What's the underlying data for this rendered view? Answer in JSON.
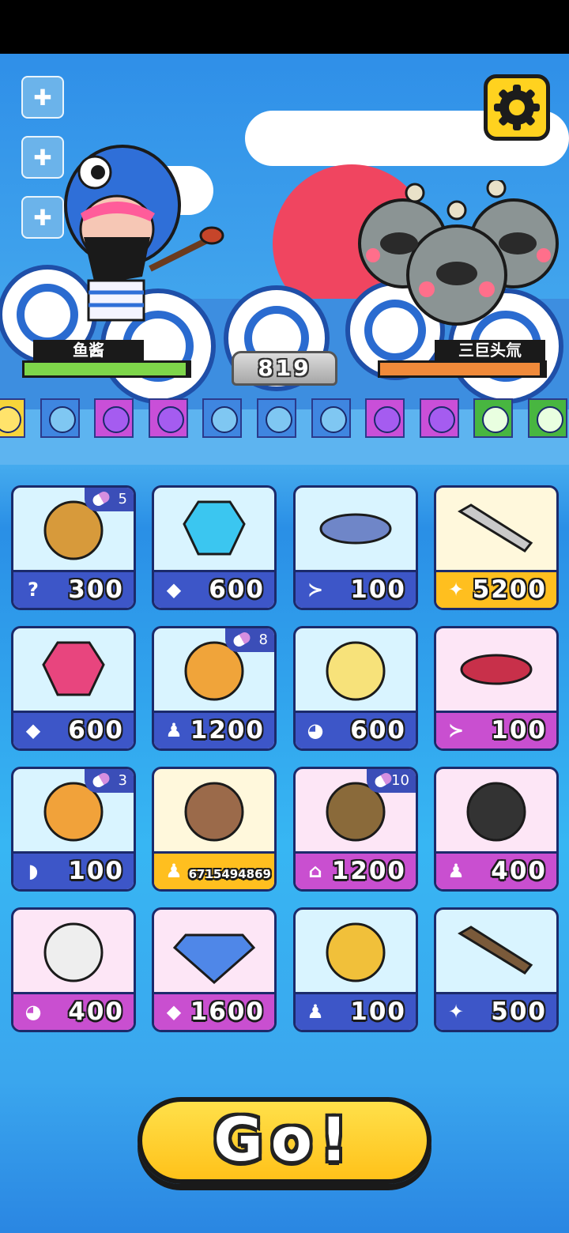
{
  "player": {
    "name": "鱼酱",
    "hp_fraction": 0.98
  },
  "enemy": {
    "name": "三巨头氚",
    "hp_fraction": 0.97
  },
  "score": "819",
  "queue": [
    {
      "kind": "coin",
      "color": "#ffd21f"
    },
    {
      "kind": "blue-ball",
      "color": "#5aa7e6"
    },
    {
      "kind": "purple-ball",
      "color": "#b04fd6"
    },
    {
      "kind": "purple-ball",
      "color": "#b04fd6"
    },
    {
      "kind": "blue-ball",
      "color": "#5aa7e6"
    },
    {
      "kind": "blue-ball",
      "color": "#5aa7e6"
    },
    {
      "kind": "blue-ball",
      "color": "#5aa7e6"
    },
    {
      "kind": "purple-ball",
      "color": "#b04fd6"
    },
    {
      "kind": "purple-ball",
      "color": "#b04fd6"
    },
    {
      "kind": "green-card",
      "color": "#4fc24a"
    },
    {
      "kind": "green-card",
      "color": "#4fc24a"
    }
  ],
  "shop": [
    {
      "item": "treasure-chest",
      "currency": "question-icon",
      "price": "300",
      "theme": "blue",
      "badge": "5"
    },
    {
      "item": "blue-gem",
      "currency": "diamond-icon",
      "price": "600",
      "theme": "blue"
    },
    {
      "item": "fish",
      "currency": "fish-icon",
      "price": "100",
      "theme": "blue"
    },
    {
      "item": "sword",
      "currency": "sword-icon",
      "price": "5200",
      "theme": "gold"
    },
    {
      "item": "pink-gem",
      "currency": "diamond-icon",
      "price": "600",
      "theme": "blue"
    },
    {
      "item": "fox-kid",
      "currency": "person-icon",
      "price": "1200",
      "theme": "blue",
      "badge": "8"
    },
    {
      "item": "chicken",
      "currency": "cat-icon",
      "price": "600",
      "theme": "blue"
    },
    {
      "item": "koi-fish",
      "currency": "fish-icon",
      "price": "100",
      "theme": "pink"
    },
    {
      "item": "drumstick",
      "currency": "bread-icon",
      "price": "100",
      "theme": "blue",
      "badge": "3"
    },
    {
      "item": "girl",
      "currency": "person-icon",
      "price": "6715494869",
      "theme": "gold"
    },
    {
      "item": "mine",
      "currency": "house-icon",
      "price": "1200",
      "theme": "pink",
      "badge": "10"
    },
    {
      "item": "top-hat-man",
      "currency": "person-icon",
      "price": "400",
      "theme": "pink"
    },
    {
      "item": "cat",
      "currency": "cat-icon",
      "price": "400",
      "theme": "pink"
    },
    {
      "item": "big-diamond",
      "currency": "diamond-icon",
      "price": "1600",
      "theme": "pink"
    },
    {
      "item": "miner",
      "currency": "person-icon",
      "price": "100",
      "theme": "blue"
    },
    {
      "item": "pickaxe",
      "currency": "sword-icon",
      "price": "500",
      "theme": "blue"
    }
  ],
  "go_label": "Go!"
}
